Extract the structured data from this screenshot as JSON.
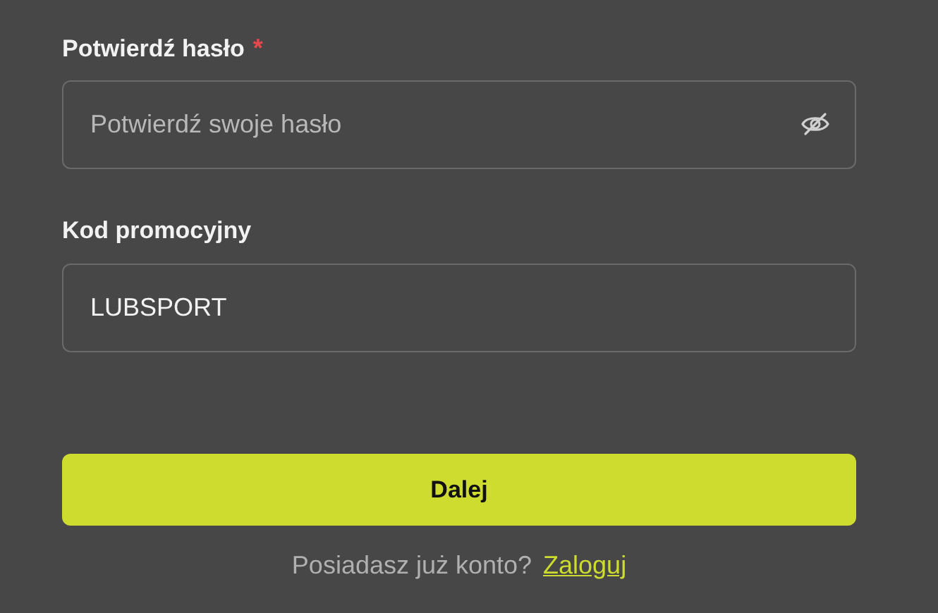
{
  "fields": [
    {
      "kind": "password",
      "label": "Potwierdź hasło",
      "required_mark": "*",
      "placeholder": "Potwierdź swoje hasło"
    },
    {
      "kind": "text",
      "label": "Kod promocyjny",
      "value": "LUBSPORT"
    }
  ],
  "submit": {
    "label": "Dalej"
  },
  "footer": {
    "text": "Posiadasz już konto?",
    "link": "Zaloguj"
  }
}
